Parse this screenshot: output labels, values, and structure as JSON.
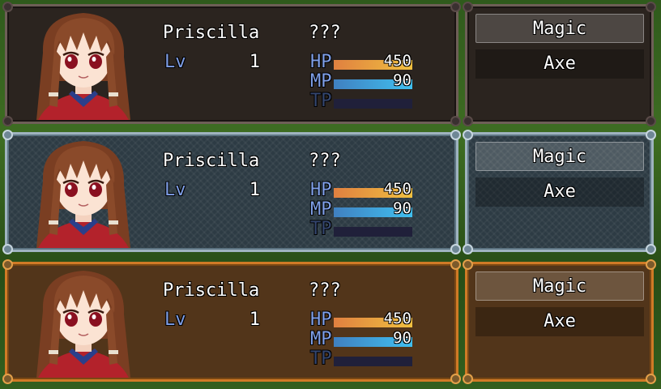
{
  "rows": [
    {
      "theme": "dark",
      "actor": {
        "name": "Priscilla",
        "class": "???",
        "level_label": "Lv",
        "level": "1"
      },
      "gauges": {
        "hp": {
          "label": "HP",
          "value": "450",
          "rate": 1.0
        },
        "mp": {
          "label": "MP",
          "value": "90",
          "rate": 1.0
        },
        "tp": {
          "label": "TP",
          "rate": 0.0
        }
      },
      "commands": [
        {
          "label": "Magic"
        },
        {
          "label": "Axe"
        }
      ]
    },
    {
      "theme": "blue",
      "actor": {
        "name": "Priscilla",
        "class": "???",
        "level_label": "Lv",
        "level": "1"
      },
      "gauges": {
        "hp": {
          "label": "HP",
          "value": "450",
          "rate": 1.0
        },
        "mp": {
          "label": "MP",
          "value": "90",
          "rate": 1.0
        },
        "tp": {
          "label": "TP",
          "rate": 0.0
        }
      },
      "commands": [
        {
          "label": "Magic"
        },
        {
          "label": "Axe"
        }
      ]
    },
    {
      "theme": "orange",
      "actor": {
        "name": "Priscilla",
        "class": "???",
        "level_label": "Lv",
        "level": "1"
      },
      "gauges": {
        "hp": {
          "label": "HP",
          "value": "450",
          "rate": 1.0
        },
        "mp": {
          "label": "MP",
          "value": "90",
          "rate": 1.0
        },
        "tp": {
          "label": "TP",
          "rate": 0.0
        }
      },
      "commands": [
        {
          "label": "Magic"
        },
        {
          "label": "Axe"
        }
      ]
    }
  ],
  "colors": {
    "hp_gauge": [
      "#e08040",
      "#f0c040"
    ],
    "mp_gauge": [
      "#4080c0",
      "#40c0f0"
    ],
    "system_text": "#7f9fe8"
  }
}
